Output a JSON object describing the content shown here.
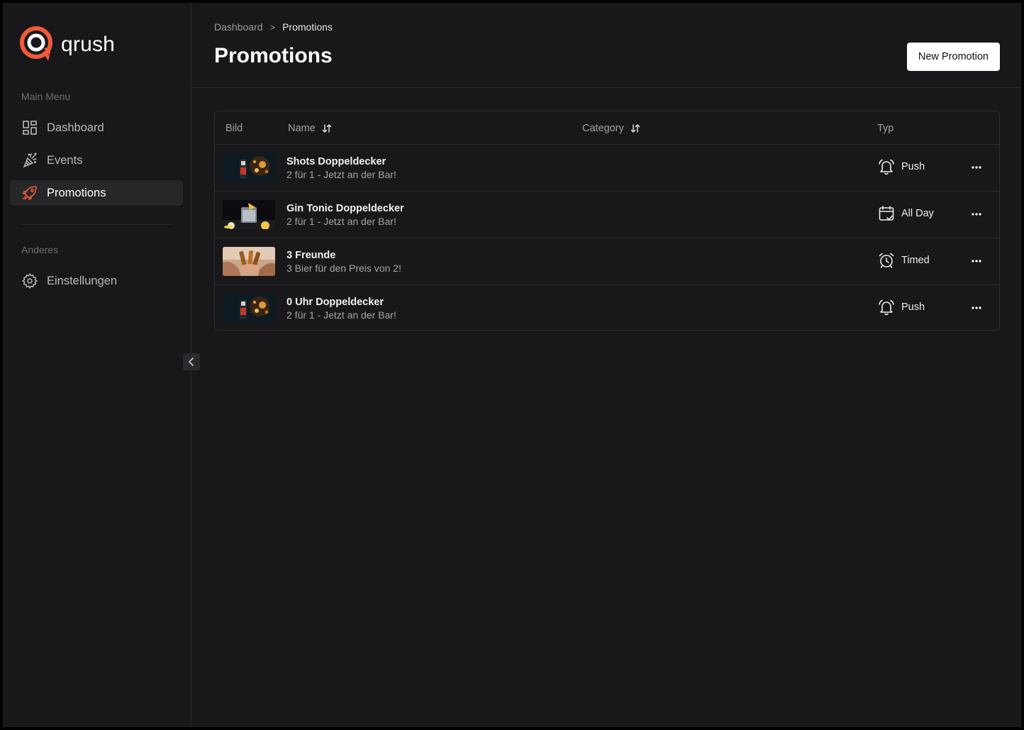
{
  "brand": {
    "name": "qrush",
    "accent": "#f05a3a"
  },
  "sidebar": {
    "main_menu_label": "Main Menu",
    "items": [
      {
        "label": "Dashboard",
        "icon": "dashboard-grid-icon",
        "active": false
      },
      {
        "label": "Events",
        "icon": "party-popper-icon",
        "active": false
      },
      {
        "label": "Promotions",
        "icon": "rocket-icon",
        "active": true
      }
    ],
    "other_label": "Anderes",
    "other_items": [
      {
        "label": "Einstellungen",
        "icon": "gear-icon"
      }
    ]
  },
  "breadcrumb": {
    "parent": "Dashboard",
    "separator": ">",
    "current": "Promotions"
  },
  "page": {
    "title": "Promotions",
    "new_button": "New Promotion"
  },
  "table": {
    "columns": {
      "image": "Bild",
      "name": "Name",
      "category": "Category",
      "type": "Typ"
    },
    "rows": [
      {
        "title": "Shots Doppeldecker",
        "subtitle": "2 für 1 - Jetzt an der Bar!",
        "type": "Push",
        "type_icon": "bell-ringing-icon",
        "thumb": "shots-thumbnail"
      },
      {
        "title": "Gin Tonic Doppeldecker",
        "subtitle": "2 für 1 - Jetzt an der Bar!",
        "type": "All Day",
        "type_icon": "calendar-check-icon",
        "thumb": "gin-tonic-thumbnail"
      },
      {
        "title": "3 Freunde",
        "subtitle": "3 Bier für den Preis von 2!",
        "type": "Timed",
        "type_icon": "alarm-clock-icon",
        "thumb": "beer-cheers-thumbnail"
      },
      {
        "title": "0 Uhr Doppeldecker",
        "subtitle": "2 für 1 - Jetzt an der Bar!",
        "type": "Push",
        "type_icon": "bell-ringing-icon",
        "thumb": "shots-thumbnail"
      }
    ]
  }
}
